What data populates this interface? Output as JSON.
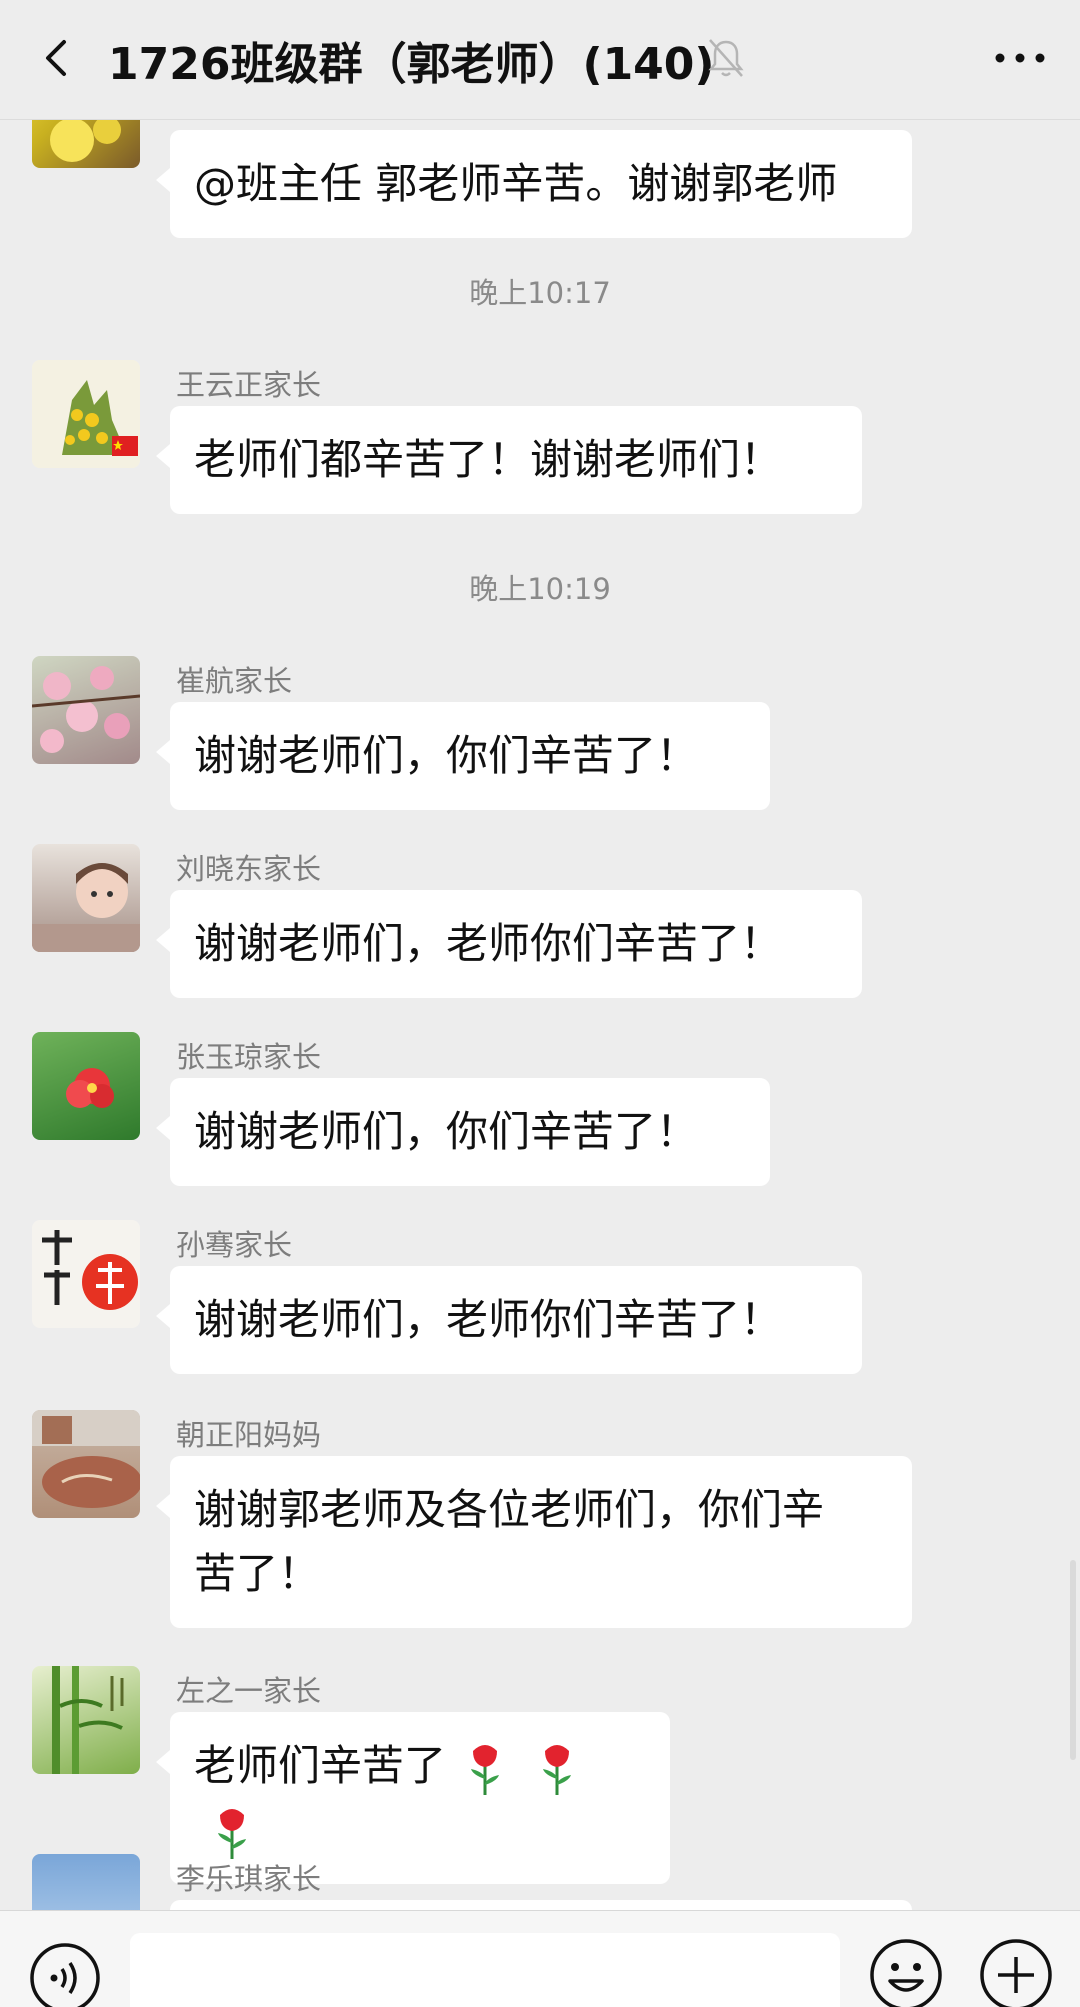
{
  "header": {
    "title": "1726班级群（郭老师）(140)",
    "back_icon": "chevron-left-icon",
    "mute_icon": "bell-off-icon",
    "more_icon": "ellipsis-icon"
  },
  "messages": [
    {
      "sender": "",
      "text": "@班主任  郭老师辛苦。谢谢郭老师"
    },
    {
      "time": "晚上10:17"
    },
    {
      "sender": "王云正家长",
      "text": "老师们都辛苦了！谢谢老师们！"
    },
    {
      "time": "晚上10:19"
    },
    {
      "sender": "崔航家长",
      "text": "谢谢老师们，你们辛苦了！"
    },
    {
      "sender": "刘晓东家长",
      "text": "谢谢老师们，老师你们辛苦了！"
    },
    {
      "sender": "张玉琼家长",
      "text": "谢谢老师们，你们辛苦了！"
    },
    {
      "sender": "孙骞家长",
      "text": "谢谢老师们，老师你们辛苦了！"
    },
    {
      "sender": "朝正阳妈妈",
      "text_line1": "谢谢郭老师及各位老师们，你们辛",
      "text_line2": "苦了！"
    },
    {
      "sender": "左之一家长",
      "text": "老师们辛苦了",
      "emoji": "rose-icon x3"
    },
    {
      "sender": "李乐琪家长",
      "text": ""
    }
  ],
  "input_bar": {
    "voice_icon": "voice-icon",
    "emoji_icon": "smiley-icon",
    "plus_icon": "plus-icon",
    "placeholder": ""
  },
  "colors": {
    "background": "#ededed",
    "bubble": "#ffffff",
    "sender": "#7d7d7d",
    "time": "#8a8a8a"
  }
}
